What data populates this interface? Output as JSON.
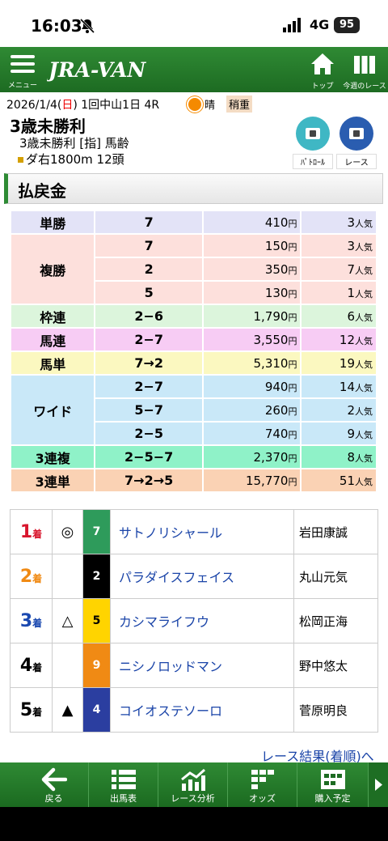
{
  "status": {
    "time": "16:03",
    "network": "4G",
    "battery": "95"
  },
  "nav": {
    "menu_label": "メニュー",
    "logo": "JRA-VAN",
    "top_label": "トップ",
    "week_label": "今週のレース"
  },
  "race": {
    "date_prefix": "2026/1/4(",
    "day": "日",
    "date_suffix": ") 1回中山1日 4R",
    "weather": "晴",
    "track": "稍重",
    "title": "3歳未勝利",
    "subtitle": "3歳未勝利 [指] 馬齢",
    "course": "ダ右1800m 12頭",
    "patrol_label": "ﾊﾟﾄﾛｰﾙ",
    "race_label": "レース"
  },
  "section": {
    "title": "払戻金"
  },
  "payout": [
    {
      "bet": "単勝",
      "combo": "7",
      "pay": "410",
      "pop": "3",
      "bg": "#e3e3f7",
      "rows": 1
    },
    {
      "bet": "複勝",
      "combo": "7",
      "pay": "150",
      "pop": "3",
      "bg": "#fde0dc",
      "rows": 3
    },
    {
      "bet": "",
      "combo": "2",
      "pay": "350",
      "pop": "7",
      "bg": "#fde0dc",
      "rows": 0
    },
    {
      "bet": "",
      "combo": "5",
      "pay": "130",
      "pop": "1",
      "bg": "#fde0dc",
      "rows": 0
    },
    {
      "bet": "枠連",
      "combo": "2−6",
      "pay": "1,790",
      "pop": "6",
      "bg": "#dcf5dc",
      "rows": 1
    },
    {
      "bet": "馬連",
      "combo": "2−7",
      "pay": "3,550",
      "pop": "12",
      "bg": "#f7ccf4",
      "rows": 1
    },
    {
      "bet": "馬単",
      "combo": "7→2",
      "pay": "5,310",
      "pop": "19",
      "bg": "#fbf8c0",
      "rows": 1
    },
    {
      "bet": "ワイド",
      "combo": "2−7",
      "pay": "940",
      "pop": "14",
      "bg": "#c9e8f8",
      "rows": 3
    },
    {
      "bet": "",
      "combo": "5−7",
      "pay": "260",
      "pop": "2",
      "bg": "#c9e8f8",
      "rows": 0
    },
    {
      "bet": "",
      "combo": "2−5",
      "pay": "740",
      "pop": "9",
      "bg": "#c9e8f8",
      "rows": 0
    },
    {
      "bet": "3連複",
      "combo": "2−5−7",
      "pay": "2,370",
      "pop": "8",
      "bg": "#8ff2c8",
      "rows": 1
    },
    {
      "bet": "3連単",
      "combo": "7→2→5",
      "pay": "15,770",
      "pop": "51",
      "bg": "#fad2b4",
      "rows": 1
    }
  ],
  "units": {
    "yen": "円",
    "pop": "人気"
  },
  "results": [
    {
      "rank": "1",
      "suffix": "着",
      "rank_color": "#d8162d",
      "mark": "◎",
      "waku": "7",
      "waku_bg": "#2e9b5b",
      "waku_fg": "#ffffff",
      "horse": "サトノリシャール",
      "jockey": "岩田康誠"
    },
    {
      "rank": "2",
      "suffix": "着",
      "rank_color": "#f08a14",
      "mark": "",
      "waku": "2",
      "waku_bg": "#000000",
      "waku_fg": "#ffffff",
      "horse": "パラダイスフェイス",
      "jockey": "丸山元気"
    },
    {
      "rank": "3",
      "suffix": "着",
      "rank_color": "#1b49b0",
      "mark": "△",
      "waku": "5",
      "waku_bg": "#ffd400",
      "waku_fg": "#000000",
      "horse": "カシマライフウ",
      "jockey": "松岡正海"
    },
    {
      "rank": "4",
      "suffix": "着",
      "rank_color": "#000000",
      "mark": "",
      "waku": "9",
      "waku_bg": "#f08a14",
      "waku_fg": "#ffffff",
      "horse": "ニシノロッドマン",
      "jockey": "野中悠太"
    },
    {
      "rank": "5",
      "suffix": "着",
      "rank_color": "#000000",
      "mark": "▲",
      "waku": "4",
      "waku_bg": "#2b3ea0",
      "waku_fg": "#ffffff",
      "horse": "コイオステソーロ",
      "jockey": "菅原明良"
    }
  ],
  "more_link": "レース結果(着順)へ",
  "bottom": [
    {
      "label": "戻る",
      "icon": "back-arrow-icon"
    },
    {
      "label": "出馬表",
      "icon": "list-icon"
    },
    {
      "label": "レース分析",
      "icon": "chart-icon"
    },
    {
      "label": "オッズ",
      "icon": "odds-icon"
    },
    {
      "label": "購入予定",
      "icon": "ticket-icon"
    }
  ]
}
